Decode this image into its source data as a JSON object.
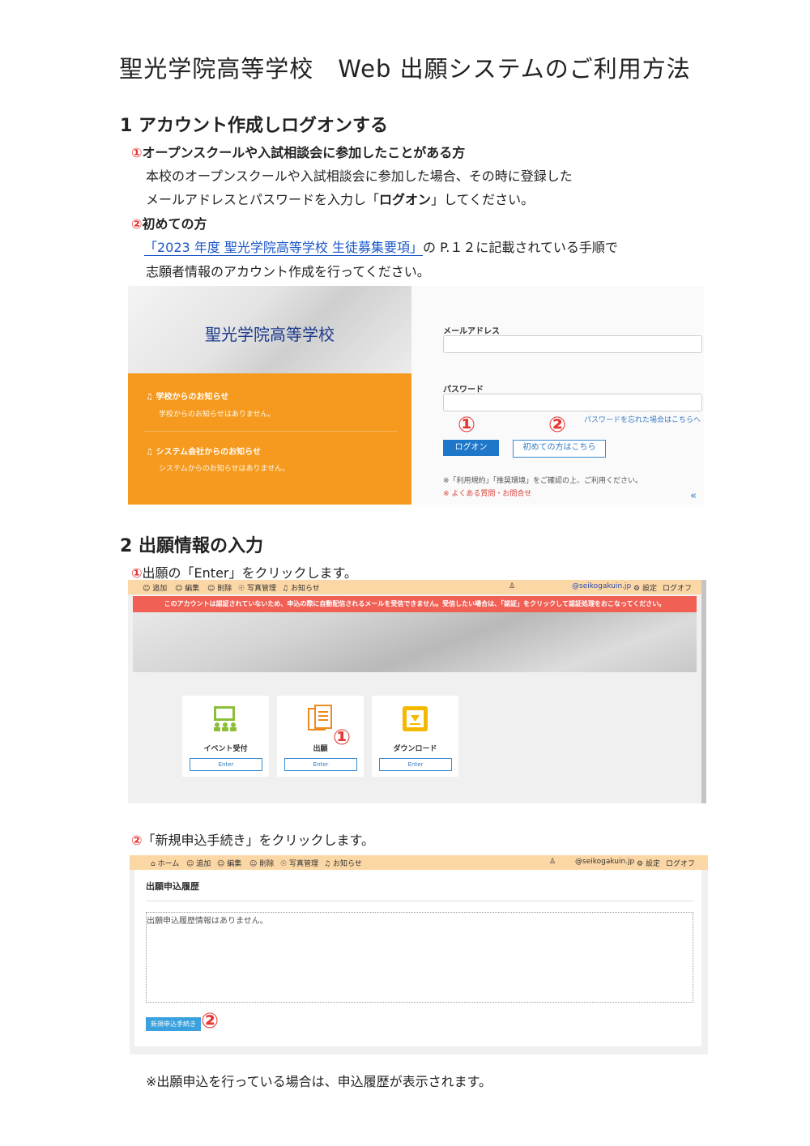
{
  "doc": {
    "title": "聖光学院高等学校　Web 出願システムのご利用方法",
    "s1": {
      "heading": "1  アカウント作成しログオンする",
      "i1_num": "①",
      "i1_title": "オープンスクールや入試相談会に参加したことがある方",
      "i1_text1": "本校のオープンスクールや入試相談会に参加した場合、その時に登録した",
      "i1_text2a": "メールアドレスとパスワードを入力し「",
      "i1_text2b": "ログオン",
      "i1_text2c": "」してください。",
      "i2_num": "②",
      "i2_title": "初めての方",
      "i2_link": "「2023 年度  聖光学院高等学校  生徒募集要項」",
      "i2_text1": "の P.１２に記載されている手順で",
      "i2_text2": "志願者情報のアカウント作成を行ってください。"
    },
    "s2": {
      "heading": "2  出願情報の入力",
      "step1_num": "①",
      "step1_text": "出願の「Enter」をクリックします。",
      "step2_num": "②",
      "step2_text": "「新規申込手続き」をクリックします。",
      "footnote": "※出願申込を行っている場合は、申込履歴が表示されます。"
    }
  },
  "login_shot": {
    "school_name": "聖光学院高等学校",
    "notice1_title": "学校からのお知らせ",
    "notice1_body": "学校からのお知らせはありません。",
    "notice2_title": "システム会社からのお知らせ",
    "notice2_body": "システムからのお知らせはありません。",
    "email_label": "メールアドレス",
    "password_label": "パスワード",
    "forgot_link": "パスワードを忘れた場合はこちらへ",
    "logon_button": "ログオン",
    "first_time_button": "初めての方はこちら",
    "marker1": "①",
    "marker2": "②",
    "terms_note": "※「利用規約」「推奨環境」をご確認の上、ご利用ください。",
    "faq_note": "※ よくある質問・お問合せ",
    "collapse": "«"
  },
  "menu_shot": {
    "nav": [
      "追加",
      "編集",
      "削除",
      "写真管理",
      "お知らせ"
    ],
    "account": "@seikogakuin.jp",
    "settings": "設定",
    "logoff": "ログオフ",
    "alert": "このアカウントは認証されていないため、申込の際に自動配信されるメールを受信できません。受信したい場合は、「認証」をクリックして認証処理をおこなってください。",
    "tiles": [
      {
        "label": "イベント受付",
        "enter": "Enter"
      },
      {
        "label": "出願",
        "enter": "Enter"
      },
      {
        "label": "ダウンロード",
        "enter": "Enter"
      }
    ],
    "marker": "①"
  },
  "history_shot": {
    "nav": [
      "ホーム",
      "追加",
      "編集",
      "削除",
      "写真管理",
      "お知らせ"
    ],
    "account": "@seikogakuin.jp",
    "settings": "設定",
    "logoff": "ログオフ",
    "heading": "出願申込履歴",
    "empty_text": "出願申込履歴情報はありません。",
    "new_button": "新規申込手続き",
    "marker": "②"
  }
}
